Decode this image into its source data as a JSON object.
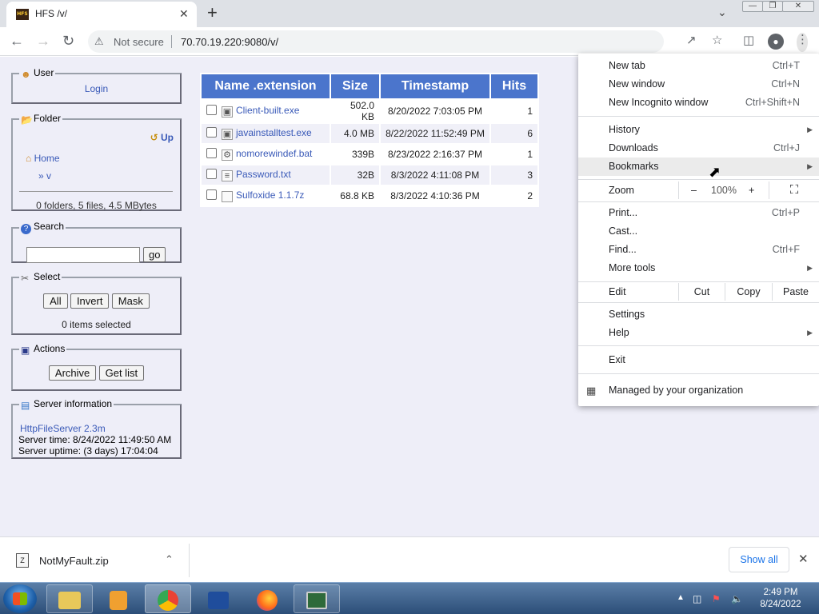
{
  "browser": {
    "tab_title": "HFS /v/",
    "favicon_text": "HFS",
    "new_tab_glyph": "+",
    "tab_close_glyph": "✕",
    "security_label": "Not secure",
    "url": "70.70.19.220:9080/v/"
  },
  "sidebar": {
    "user": {
      "legend": "User",
      "login": "Login"
    },
    "folder": {
      "legend": "Folder",
      "up": "Up",
      "home": "Home",
      "path": "» v",
      "summary": "0 folders, 5 files, 4.5 MBytes"
    },
    "search": {
      "legend": "Search",
      "go": "go",
      "value": ""
    },
    "select": {
      "legend": "Select",
      "all": "All",
      "invert": "Invert",
      "mask": "Mask",
      "status": "0 items selected"
    },
    "actions": {
      "legend": "Actions",
      "archive": "Archive",
      "get_list": "Get list"
    },
    "server": {
      "legend": "Server information",
      "version": "HttpFileServer 2.3m",
      "time": "Server time: 8/24/2022 11:49:50 AM",
      "uptime": "Server uptime: (3 days) 17:04:04"
    }
  },
  "files": {
    "headers": [
      "Name .extension",
      "Size",
      "Timestamp",
      "Hits"
    ],
    "rows": [
      {
        "name": "Client-built.exe",
        "size": "502.0 KB",
        "timestamp": "8/20/2022 7:03:05 PM",
        "hits": "1",
        "icon": "exe-icon"
      },
      {
        "name": "javainstalltest.exe",
        "size": "4.0 MB",
        "timestamp": "8/22/2022 11:52:49 PM",
        "hits": "6",
        "icon": "exe-icon"
      },
      {
        "name": "nomorewindef.bat",
        "size": "339B",
        "timestamp": "8/23/2022 2:16:37 PM",
        "hits": "1",
        "icon": "bat-icon"
      },
      {
        "name": "Password.txt",
        "size": "32B",
        "timestamp": "8/3/2022 4:11:08 PM",
        "hits": "3",
        "icon": "txt-icon"
      },
      {
        "name": "Sulfoxide 1.1.7z",
        "size": "68.8 KB",
        "timestamp": "8/3/2022 4:10:36 PM",
        "hits": "2",
        "icon": "file-icon"
      }
    ]
  },
  "menu": {
    "new_tab": "New tab",
    "new_tab_sc": "Ctrl+T",
    "new_window": "New window",
    "new_window_sc": "Ctrl+N",
    "incognito": "New Incognito window",
    "incognito_sc": "Ctrl+Shift+N",
    "history": "History",
    "downloads": "Downloads",
    "downloads_sc": "Ctrl+J",
    "bookmarks": "Bookmarks",
    "zoom": "Zoom",
    "zoom_minus": "–",
    "zoom_value": "100%",
    "zoom_plus": "+",
    "print": "Print...",
    "print_sc": "Ctrl+P",
    "cast": "Cast...",
    "find": "Find...",
    "find_sc": "Ctrl+F",
    "more_tools": "More tools",
    "edit": "Edit",
    "cut": "Cut",
    "copy": "Copy",
    "paste": "Paste",
    "settings": "Settings",
    "help": "Help",
    "exit": "Exit",
    "managed": "Managed by your organization"
  },
  "download_bar": {
    "filename": "NotMyFault.zip",
    "show_all": "Show all"
  },
  "taskbar": {
    "time": "2:49 PM",
    "date": "8/24/2022"
  },
  "colors": {
    "table_header": "#4b75cc",
    "link": "#3a5ab8",
    "page_bg": "#eeeef8",
    "menu_highlight": "#ebebeb"
  }
}
